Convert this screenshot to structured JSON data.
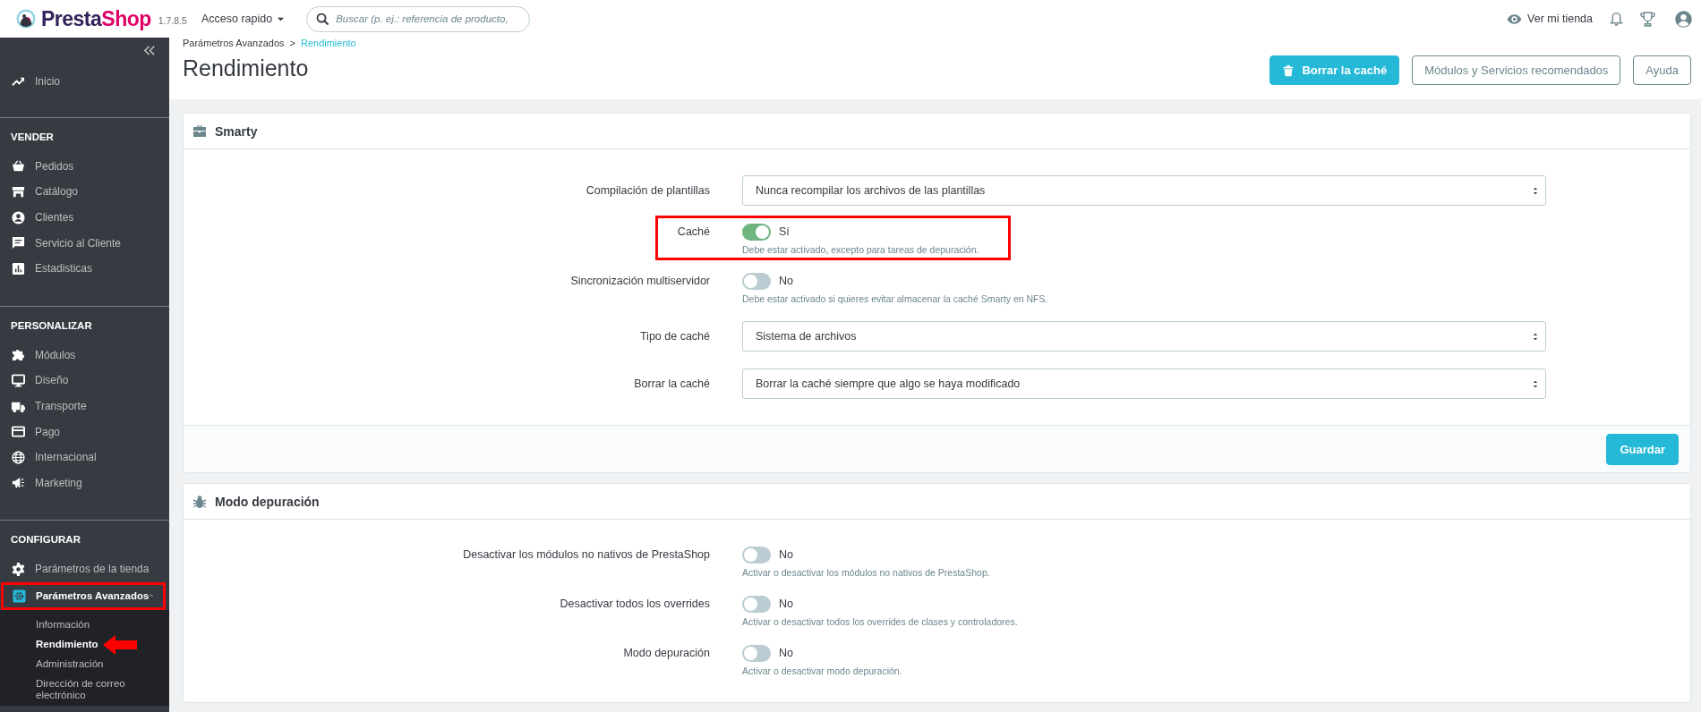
{
  "topbar": {
    "logo": [
      "Presta",
      "Shop"
    ],
    "version": "1.7.8.5",
    "quick_access": "Acceso rapido",
    "search": {
      "placeholder": "Buscar (p. ej.: referencia de producto,"
    },
    "view_store": "Ver mi tienda"
  },
  "sidebar": {
    "sections": [
      {
        "items": [
          {
            "label": "Inicio",
            "selected": false,
            "highlighted": false
          }
        ]
      },
      {
        "title": "VENDER",
        "items": [
          {
            "label": "Pedidos",
            "selected": false,
            "highlighted": false
          },
          {
            "label": "Catálogo",
            "selected": false,
            "highlighted": false
          },
          {
            "label": "Clientes",
            "selected": false,
            "highlighted": false
          },
          {
            "label": "Servicio al Cliente",
            "selected": false,
            "highlighted": false
          },
          {
            "label": "Estadisticas",
            "selected": false,
            "highlighted": false
          }
        ]
      },
      {
        "title": "PERSONALIZAR",
        "items": [
          {
            "label": "Módulos",
            "selected": false,
            "highlighted": false
          },
          {
            "label": "Diseño",
            "selected": false,
            "highlighted": false
          },
          {
            "label": "Transporte",
            "selected": false,
            "highlighted": false
          },
          {
            "label": "Pago",
            "selected": false,
            "highlighted": false
          },
          {
            "label": "Internacional",
            "selected": false,
            "highlighted": false
          },
          {
            "label": "Marketing",
            "selected": false,
            "highlighted": false
          }
        ]
      },
      {
        "title": "CONFIGURAR",
        "items": [
          {
            "label": "Parámetros de la tienda",
            "selected": false,
            "highlighted": false
          },
          {
            "label": "Parámetros Avanzados",
            "selected": true,
            "highlighted": true,
            "expanded": true,
            "children": [
              {
                "label": "Información",
                "selected": false,
                "pointer": false
              },
              {
                "label": "Rendimiento",
                "selected": true,
                "pointer": true
              },
              {
                "label": "Administración",
                "selected": false,
                "pointer": false
              },
              {
                "label": "Dirección de correo electrónico",
                "selected": false,
                "pointer": false
              }
            ]
          }
        ]
      }
    ]
  },
  "header": {
    "breadcrumb": [
      {
        "label": "Parámetros Avanzados",
        "selected": false
      },
      {
        "label": "Rendimiento",
        "selected": true
      }
    ],
    "breadcrumb_separator": ">",
    "title": "Rendimiento",
    "buttons": [
      {
        "label": "Borrar la caché",
        "kind": "primary"
      },
      {
        "label": "Módulos y Servicios recomendados",
        "kind": "outline"
      },
      {
        "label": "Ayuda",
        "kind": "outline"
      }
    ]
  },
  "panels": [
    {
      "title": "Smarty",
      "fields": [
        {
          "kind": "select",
          "label": "Compilación de plantillas",
          "value": "Nunca recompilar los archivos de las plantillas",
          "highlighted": false
        },
        {
          "kind": "switch",
          "label": "Caché",
          "on": true,
          "state_text": "Sí",
          "help": "Debe estar activado, excepto para tareas de depuración.",
          "highlighted": true
        },
        {
          "kind": "switch",
          "label": "Sincronización multiservidor",
          "on": false,
          "state_text": "No",
          "help": "Debe estar activado si quieres evitar almacenar la caché Smarty en NFS.",
          "highlighted": false
        },
        {
          "kind": "select",
          "label": "Tipo de caché",
          "value": "Sistema de archivos",
          "highlighted": false
        },
        {
          "kind": "select",
          "label": "Borrar la caché",
          "value": "Borrar la caché siempre que algo se haya modificado",
          "highlighted": false
        }
      ],
      "footer_button": "Guardar"
    },
    {
      "title": "Modo depuración",
      "fields": [
        {
          "kind": "switch",
          "label": "Desactivar los módulos no nativos de PrestaShop",
          "on": false,
          "state_text": "No",
          "help": "Activar o desactivar los módulos no nativos de PrestaShop.",
          "highlighted": false
        },
        {
          "kind": "switch",
          "label": "Desactivar todos los overrides",
          "on": false,
          "state_text": "No",
          "help": "Activar o desactivar todos los overrides de clases y controladores.",
          "highlighted": false
        },
        {
          "kind": "switch",
          "label": "Modo depuración",
          "on": false,
          "state_text": "No",
          "help": "Activar o desactivar modo depuración.",
          "highlighted": false
        }
      ]
    }
  ]
}
